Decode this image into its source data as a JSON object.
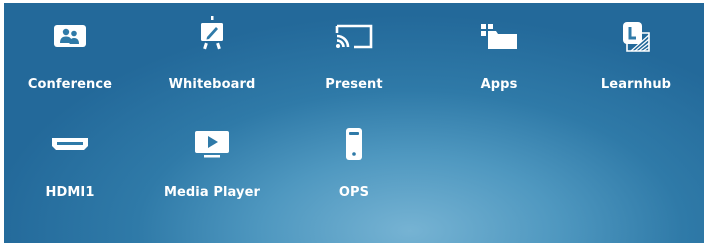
{
  "apps": {
    "row1": [
      {
        "label": "Conference",
        "icon": "conference-icon"
      },
      {
        "label": "Whiteboard",
        "icon": "whiteboard-icon"
      },
      {
        "label": "Present",
        "icon": "cast-icon"
      },
      {
        "label": "Apps",
        "icon": "apps-icon"
      },
      {
        "label": "Learnhub",
        "icon": "learnhub-icon"
      }
    ],
    "row2": [
      {
        "label": "HDMI1",
        "icon": "hdmi-icon"
      },
      {
        "label": "Media Player",
        "icon": "media-player-icon"
      },
      {
        "label": "OPS",
        "icon": "ops-icon"
      }
    ]
  },
  "colors": {
    "background_dark": "#23699a",
    "background_light": "#76b3d3",
    "icon": "#ffffff",
    "label": "#ffffff"
  }
}
